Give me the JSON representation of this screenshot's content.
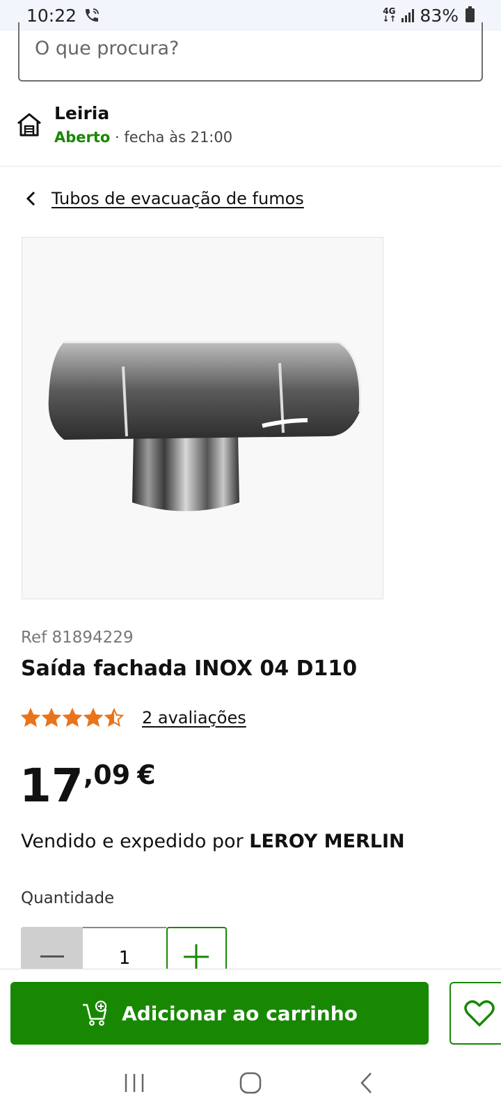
{
  "status_bar": {
    "time": "10:22",
    "network": "4G",
    "battery": "83%"
  },
  "search": {
    "placeholder": "O que procura?"
  },
  "store": {
    "name": "Leiria",
    "status": "Aberto",
    "hours": " · fecha às 21:00"
  },
  "breadcrumb": {
    "label": "Tubos de evacuação de fumos"
  },
  "product": {
    "ref": "Ref 81894229",
    "title": "Saída fachada INOX 04 D110",
    "rating": 4.5,
    "reviews_label": "2 avaliações",
    "price_int": "17",
    "price_dec": ",09",
    "price_currency": "€",
    "seller_prefix": "Vendido e expedido por ",
    "seller_name": "LEROY MERLIN"
  },
  "quantity": {
    "label": "Quantidade",
    "value": "1"
  },
  "actions": {
    "add_to_cart": "Adicionar ao carrinho"
  },
  "colors": {
    "accent": "#188803",
    "star": "#e8741c"
  }
}
